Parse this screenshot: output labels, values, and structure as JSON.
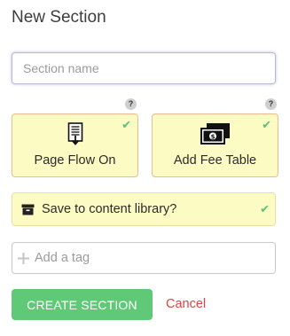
{
  "title": "New Section",
  "section_name": {
    "value": "",
    "placeholder": "Section name"
  },
  "help_marks": {
    "page_flow": "?",
    "fee_table": "?"
  },
  "options": [
    {
      "label": "Page Flow On",
      "icon": "document-flow-icon",
      "checked": true
    },
    {
      "label": "Add Fee Table",
      "icon": "money-table-icon",
      "checked": true
    }
  ],
  "library": {
    "label": "Save to content library?",
    "icon": "archive-box-icon",
    "checked": true
  },
  "tag": {
    "placeholder": "Add a tag",
    "icon": "plus-icon"
  },
  "actions": {
    "create_label": "CREATE SECTION",
    "cancel_label": "Cancel"
  },
  "colors": {
    "card_bg": "#fdfbc4",
    "card_border": "#f1b98c",
    "check": "#5fbf73",
    "primary": "#5fc978",
    "cancel": "#d64545"
  }
}
